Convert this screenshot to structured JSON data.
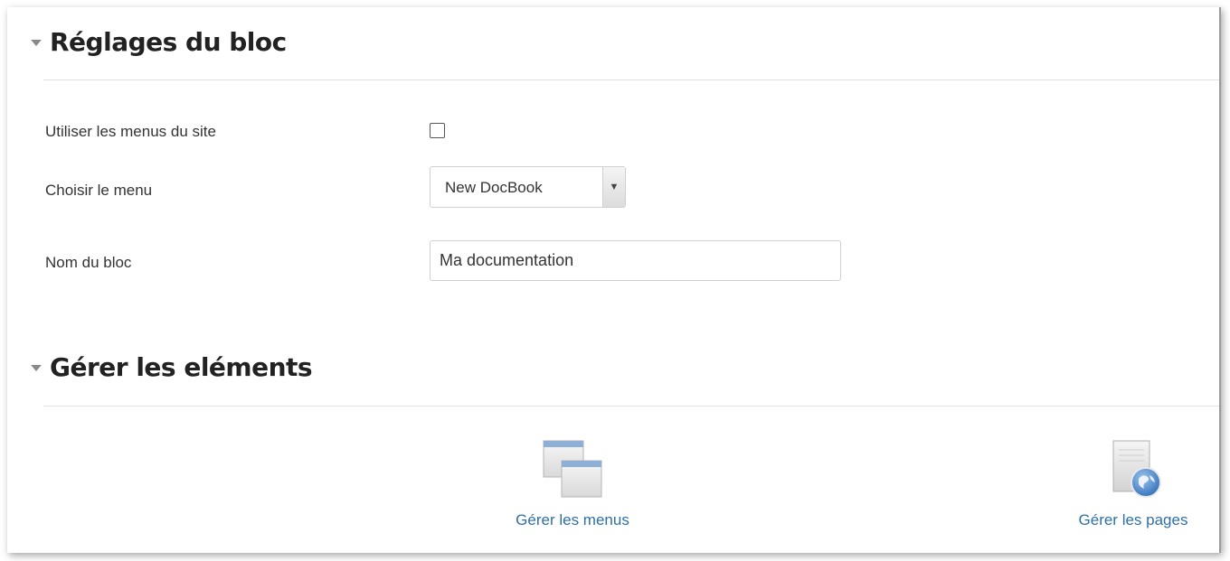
{
  "sections": {
    "block_settings": {
      "title": "Réglages du bloc"
    },
    "manage_elements": {
      "title": "Gérer les eléments"
    }
  },
  "form": {
    "use_site_menus": {
      "label": "Utiliser les menus du site",
      "checked": false
    },
    "choose_menu": {
      "label": "Choisir le menu",
      "selected": "New DocBook"
    },
    "block_name": {
      "label": "Nom du bloc",
      "value": "Ma documentation"
    }
  },
  "manage": {
    "menus": {
      "label": "Gérer les menus",
      "icon": "windows-icon"
    },
    "pages": {
      "label": "Gérer les pages",
      "icon": "globe-page-icon"
    }
  },
  "colors": {
    "link": "#2f6fa8",
    "heading": "#222222",
    "divider": "#e2e2e2"
  }
}
